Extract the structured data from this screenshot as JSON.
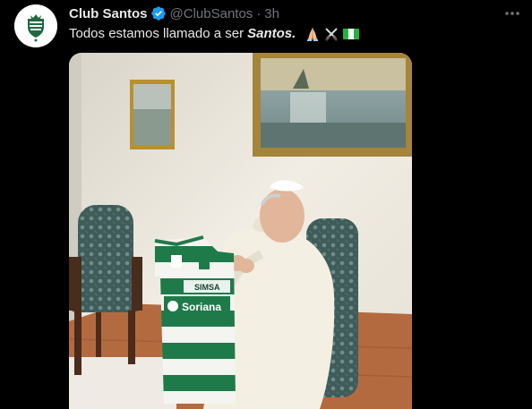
{
  "tweet": {
    "display_name": "Club Santos",
    "handle": "@ClubSantos",
    "separator": "·",
    "time": "3h",
    "more_label": "•••",
    "text_before": "Todos estamos llamado a ser",
    "text_emphasis": "Santos.",
    "emoji_icons": [
      "folded-hands-icon",
      "crossed-swords-icon",
      "flag-icon"
    ]
  },
  "jersey": {
    "sponsor_top": "SIMSA",
    "sponsor_main": "Soriana"
  },
  "colors": {
    "background": "#000000",
    "text_primary": "#e7e9ea",
    "text_secondary": "#71767b",
    "verified": "#1d9bf0",
    "santos_green": "#2e7d4f"
  }
}
